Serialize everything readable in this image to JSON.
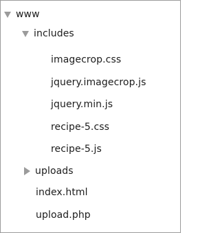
{
  "tree": {
    "root": {
      "label": "www",
      "icon": "triangle-down-icon",
      "expanded": true
    },
    "includes": {
      "label": "includes",
      "icon": "triangle-down-icon",
      "expanded": true,
      "files": [
        "imagecrop.css",
        "jquery.imagecrop.js",
        "jquery.min.js",
        "recipe-5.css",
        "recipe-5.js"
      ]
    },
    "uploads": {
      "label": "uploads",
      "icon": "triangle-right-icon",
      "expanded": false
    },
    "files": [
      "index.html",
      "upload.php"
    ]
  },
  "colors": {
    "text": "#1c1c1c",
    "disclosure": "#9b9b9b",
    "border": "#9a9a9a"
  }
}
